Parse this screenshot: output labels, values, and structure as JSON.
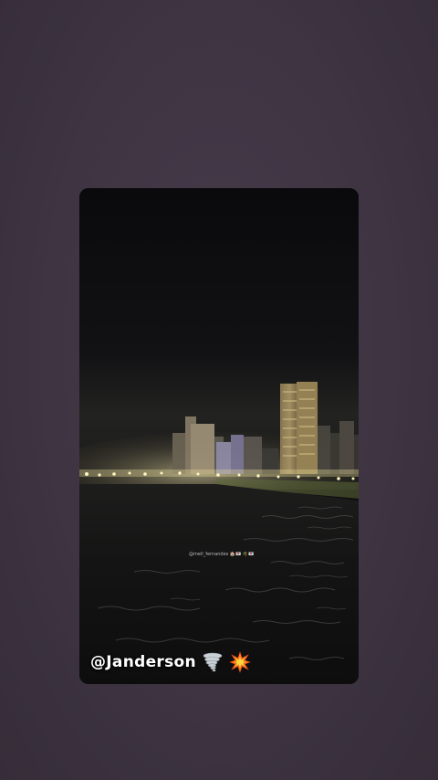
{
  "story": {
    "caption_handle": "@Janderson",
    "emoji_1": "tornado-emoji",
    "emoji_2": "collision-emoji",
    "small_mention": "@mell_fernandes 🏠💌 🌴💌"
  },
  "colors": {
    "background": "#3f3541",
    "card": "#0c0b0d",
    "text": "#ffffff"
  }
}
